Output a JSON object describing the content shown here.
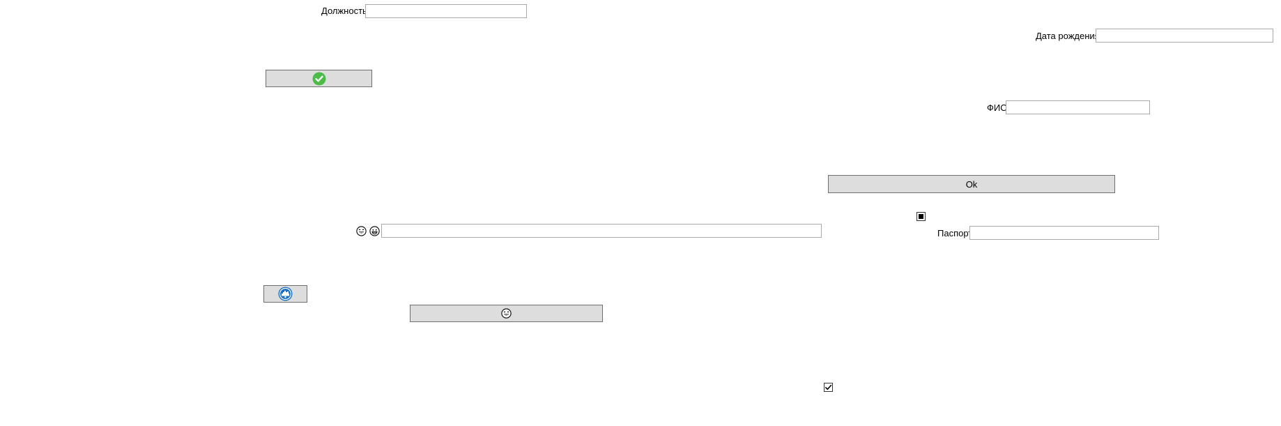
{
  "form": {
    "position_label": "Должность",
    "position_value": "",
    "birthdate_label": "Дата рождения",
    "birthdate_value": "",
    "fio_label": "ФИО",
    "fio_value": "",
    "passport_label": "Паспорт",
    "passport_value": "",
    "emoji_field_value": "",
    "ok_button_label": "Ok"
  },
  "icons": {
    "confirm": "green-check-circle-icon",
    "steam": "blue-steam-icon",
    "emoji_face": "emoji-face-icon"
  },
  "checkboxes": {
    "square_checkbox_state": "indeterminate",
    "bottom_checkbox_state": "checked"
  },
  "colors": {
    "button_bg": "#dddddd",
    "input_border": "#a9a9a9",
    "check_green": "#4cbb47",
    "steam_blue": "#1a6fc4"
  }
}
